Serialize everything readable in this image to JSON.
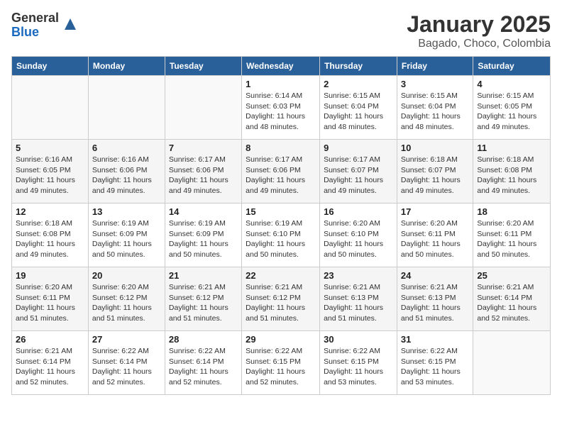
{
  "header": {
    "logo_general": "General",
    "logo_blue": "Blue",
    "month": "January 2025",
    "location": "Bagado, Choco, Colombia"
  },
  "days_of_week": [
    "Sunday",
    "Monday",
    "Tuesday",
    "Wednesday",
    "Thursday",
    "Friday",
    "Saturday"
  ],
  "weeks": [
    [
      {
        "day": "",
        "info": ""
      },
      {
        "day": "",
        "info": ""
      },
      {
        "day": "",
        "info": ""
      },
      {
        "day": "1",
        "info": "Sunrise: 6:14 AM\nSunset: 6:03 PM\nDaylight: 11 hours and 48 minutes."
      },
      {
        "day": "2",
        "info": "Sunrise: 6:15 AM\nSunset: 6:04 PM\nDaylight: 11 hours and 48 minutes."
      },
      {
        "day": "3",
        "info": "Sunrise: 6:15 AM\nSunset: 6:04 PM\nDaylight: 11 hours and 48 minutes."
      },
      {
        "day": "4",
        "info": "Sunrise: 6:15 AM\nSunset: 6:05 PM\nDaylight: 11 hours and 49 minutes."
      }
    ],
    [
      {
        "day": "5",
        "info": "Sunrise: 6:16 AM\nSunset: 6:05 PM\nDaylight: 11 hours and 49 minutes."
      },
      {
        "day": "6",
        "info": "Sunrise: 6:16 AM\nSunset: 6:06 PM\nDaylight: 11 hours and 49 minutes."
      },
      {
        "day": "7",
        "info": "Sunrise: 6:17 AM\nSunset: 6:06 PM\nDaylight: 11 hours and 49 minutes."
      },
      {
        "day": "8",
        "info": "Sunrise: 6:17 AM\nSunset: 6:06 PM\nDaylight: 11 hours and 49 minutes."
      },
      {
        "day": "9",
        "info": "Sunrise: 6:17 AM\nSunset: 6:07 PM\nDaylight: 11 hours and 49 minutes."
      },
      {
        "day": "10",
        "info": "Sunrise: 6:18 AM\nSunset: 6:07 PM\nDaylight: 11 hours and 49 minutes."
      },
      {
        "day": "11",
        "info": "Sunrise: 6:18 AM\nSunset: 6:08 PM\nDaylight: 11 hours and 49 minutes."
      }
    ],
    [
      {
        "day": "12",
        "info": "Sunrise: 6:18 AM\nSunset: 6:08 PM\nDaylight: 11 hours and 49 minutes."
      },
      {
        "day": "13",
        "info": "Sunrise: 6:19 AM\nSunset: 6:09 PM\nDaylight: 11 hours and 50 minutes."
      },
      {
        "day": "14",
        "info": "Sunrise: 6:19 AM\nSunset: 6:09 PM\nDaylight: 11 hours and 50 minutes."
      },
      {
        "day": "15",
        "info": "Sunrise: 6:19 AM\nSunset: 6:10 PM\nDaylight: 11 hours and 50 minutes."
      },
      {
        "day": "16",
        "info": "Sunrise: 6:20 AM\nSunset: 6:10 PM\nDaylight: 11 hours and 50 minutes."
      },
      {
        "day": "17",
        "info": "Sunrise: 6:20 AM\nSunset: 6:11 PM\nDaylight: 11 hours and 50 minutes."
      },
      {
        "day": "18",
        "info": "Sunrise: 6:20 AM\nSunset: 6:11 PM\nDaylight: 11 hours and 50 minutes."
      }
    ],
    [
      {
        "day": "19",
        "info": "Sunrise: 6:20 AM\nSunset: 6:11 PM\nDaylight: 11 hours and 51 minutes."
      },
      {
        "day": "20",
        "info": "Sunrise: 6:20 AM\nSunset: 6:12 PM\nDaylight: 11 hours and 51 minutes."
      },
      {
        "day": "21",
        "info": "Sunrise: 6:21 AM\nSunset: 6:12 PM\nDaylight: 11 hours and 51 minutes."
      },
      {
        "day": "22",
        "info": "Sunrise: 6:21 AM\nSunset: 6:12 PM\nDaylight: 11 hours and 51 minutes."
      },
      {
        "day": "23",
        "info": "Sunrise: 6:21 AM\nSunset: 6:13 PM\nDaylight: 11 hours and 51 minutes."
      },
      {
        "day": "24",
        "info": "Sunrise: 6:21 AM\nSunset: 6:13 PM\nDaylight: 11 hours and 51 minutes."
      },
      {
        "day": "25",
        "info": "Sunrise: 6:21 AM\nSunset: 6:14 PM\nDaylight: 11 hours and 52 minutes."
      }
    ],
    [
      {
        "day": "26",
        "info": "Sunrise: 6:21 AM\nSunset: 6:14 PM\nDaylight: 11 hours and 52 minutes."
      },
      {
        "day": "27",
        "info": "Sunrise: 6:22 AM\nSunset: 6:14 PM\nDaylight: 11 hours and 52 minutes."
      },
      {
        "day": "28",
        "info": "Sunrise: 6:22 AM\nSunset: 6:14 PM\nDaylight: 11 hours and 52 minutes."
      },
      {
        "day": "29",
        "info": "Sunrise: 6:22 AM\nSunset: 6:15 PM\nDaylight: 11 hours and 52 minutes."
      },
      {
        "day": "30",
        "info": "Sunrise: 6:22 AM\nSunset: 6:15 PM\nDaylight: 11 hours and 53 minutes."
      },
      {
        "day": "31",
        "info": "Sunrise: 6:22 AM\nSunset: 6:15 PM\nDaylight: 11 hours and 53 minutes."
      },
      {
        "day": "",
        "info": ""
      }
    ]
  ]
}
